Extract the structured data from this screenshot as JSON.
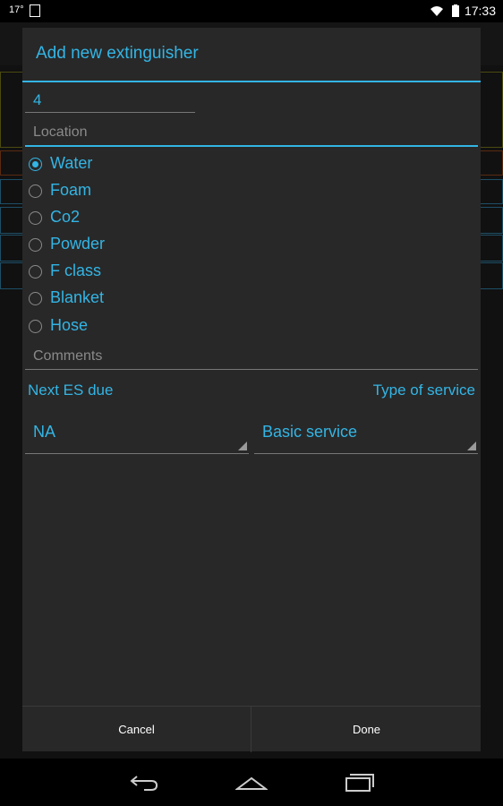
{
  "status_bar": {
    "temperature": "17°",
    "time": "17:33"
  },
  "dialog": {
    "title": "Add new extinguisher",
    "number_value": "4",
    "location_placeholder": "Location",
    "extinguisher_types": [
      {
        "label": "Water",
        "checked": true
      },
      {
        "label": "Foam",
        "checked": false
      },
      {
        "label": "Co2",
        "checked": false
      },
      {
        "label": "Powder",
        "checked": false
      },
      {
        "label": "F class",
        "checked": false
      },
      {
        "label": "Blanket",
        "checked": false
      },
      {
        "label": "Hose",
        "checked": false
      }
    ],
    "comments_placeholder": "Comments",
    "next_es_due_label": "Next ES due",
    "type_of_service_label": "Type of service",
    "next_es_due_value": "NA",
    "type_of_service_value": "Basic service",
    "cancel_label": "Cancel",
    "done_label": "Done"
  },
  "colors": {
    "accent": "#33b5e5",
    "dialog_bg": "#282828",
    "hint": "#8a8a8a"
  },
  "nav_icons": [
    "back-icon",
    "home-icon",
    "recent-apps-icon"
  ]
}
